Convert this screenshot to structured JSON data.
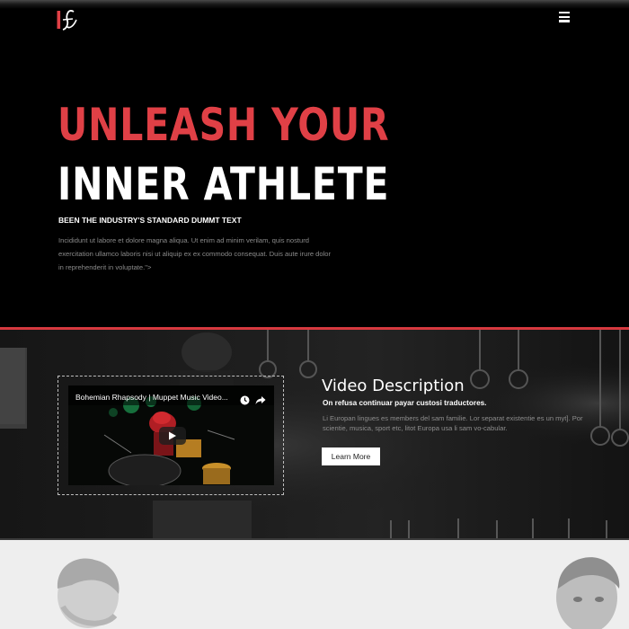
{
  "header": {
    "logo_icon": "if-logo-icon",
    "menu_icon": "hamburger-menu-icon"
  },
  "hero": {
    "headline_line1": "UNLEASH YOUR",
    "headline_line2": "INNER ATHLETE",
    "subheading": "BEEN THE INDUSTRY'S STANDARD DUMMT TEXT",
    "body": "Incididunt ut labore et dolore magna aliqua. Ut enim ad minim verilam, quis nosturd exercitation ullamco laboris nisi ut aliquip ex ex commodo consequat. Duis aute irure dolor in reprehenderit in voluptate.\">",
    "colors": {
      "accent": "#e04046",
      "background": "#000000",
      "divider": "#d6393f"
    }
  },
  "video_section": {
    "video": {
      "title": "Bohemian Rhapsody | Muppet Music Video...",
      "watch_later_icon": "clock-icon",
      "share_icon": "share-icon",
      "play_icon": "play-icon"
    },
    "description": {
      "title": "Video Description",
      "subtitle": "On refusa continuar payar custosi traductores.",
      "body": "Li Europan lingues es members del sam familie. Lor separat existentie es un myt]. Por scientie, musica, sport etc, litot Europa usa li sam vo-cabular.",
      "button_label": "Learn More"
    }
  },
  "bottom_section": {
    "background": "#eeeeee"
  }
}
